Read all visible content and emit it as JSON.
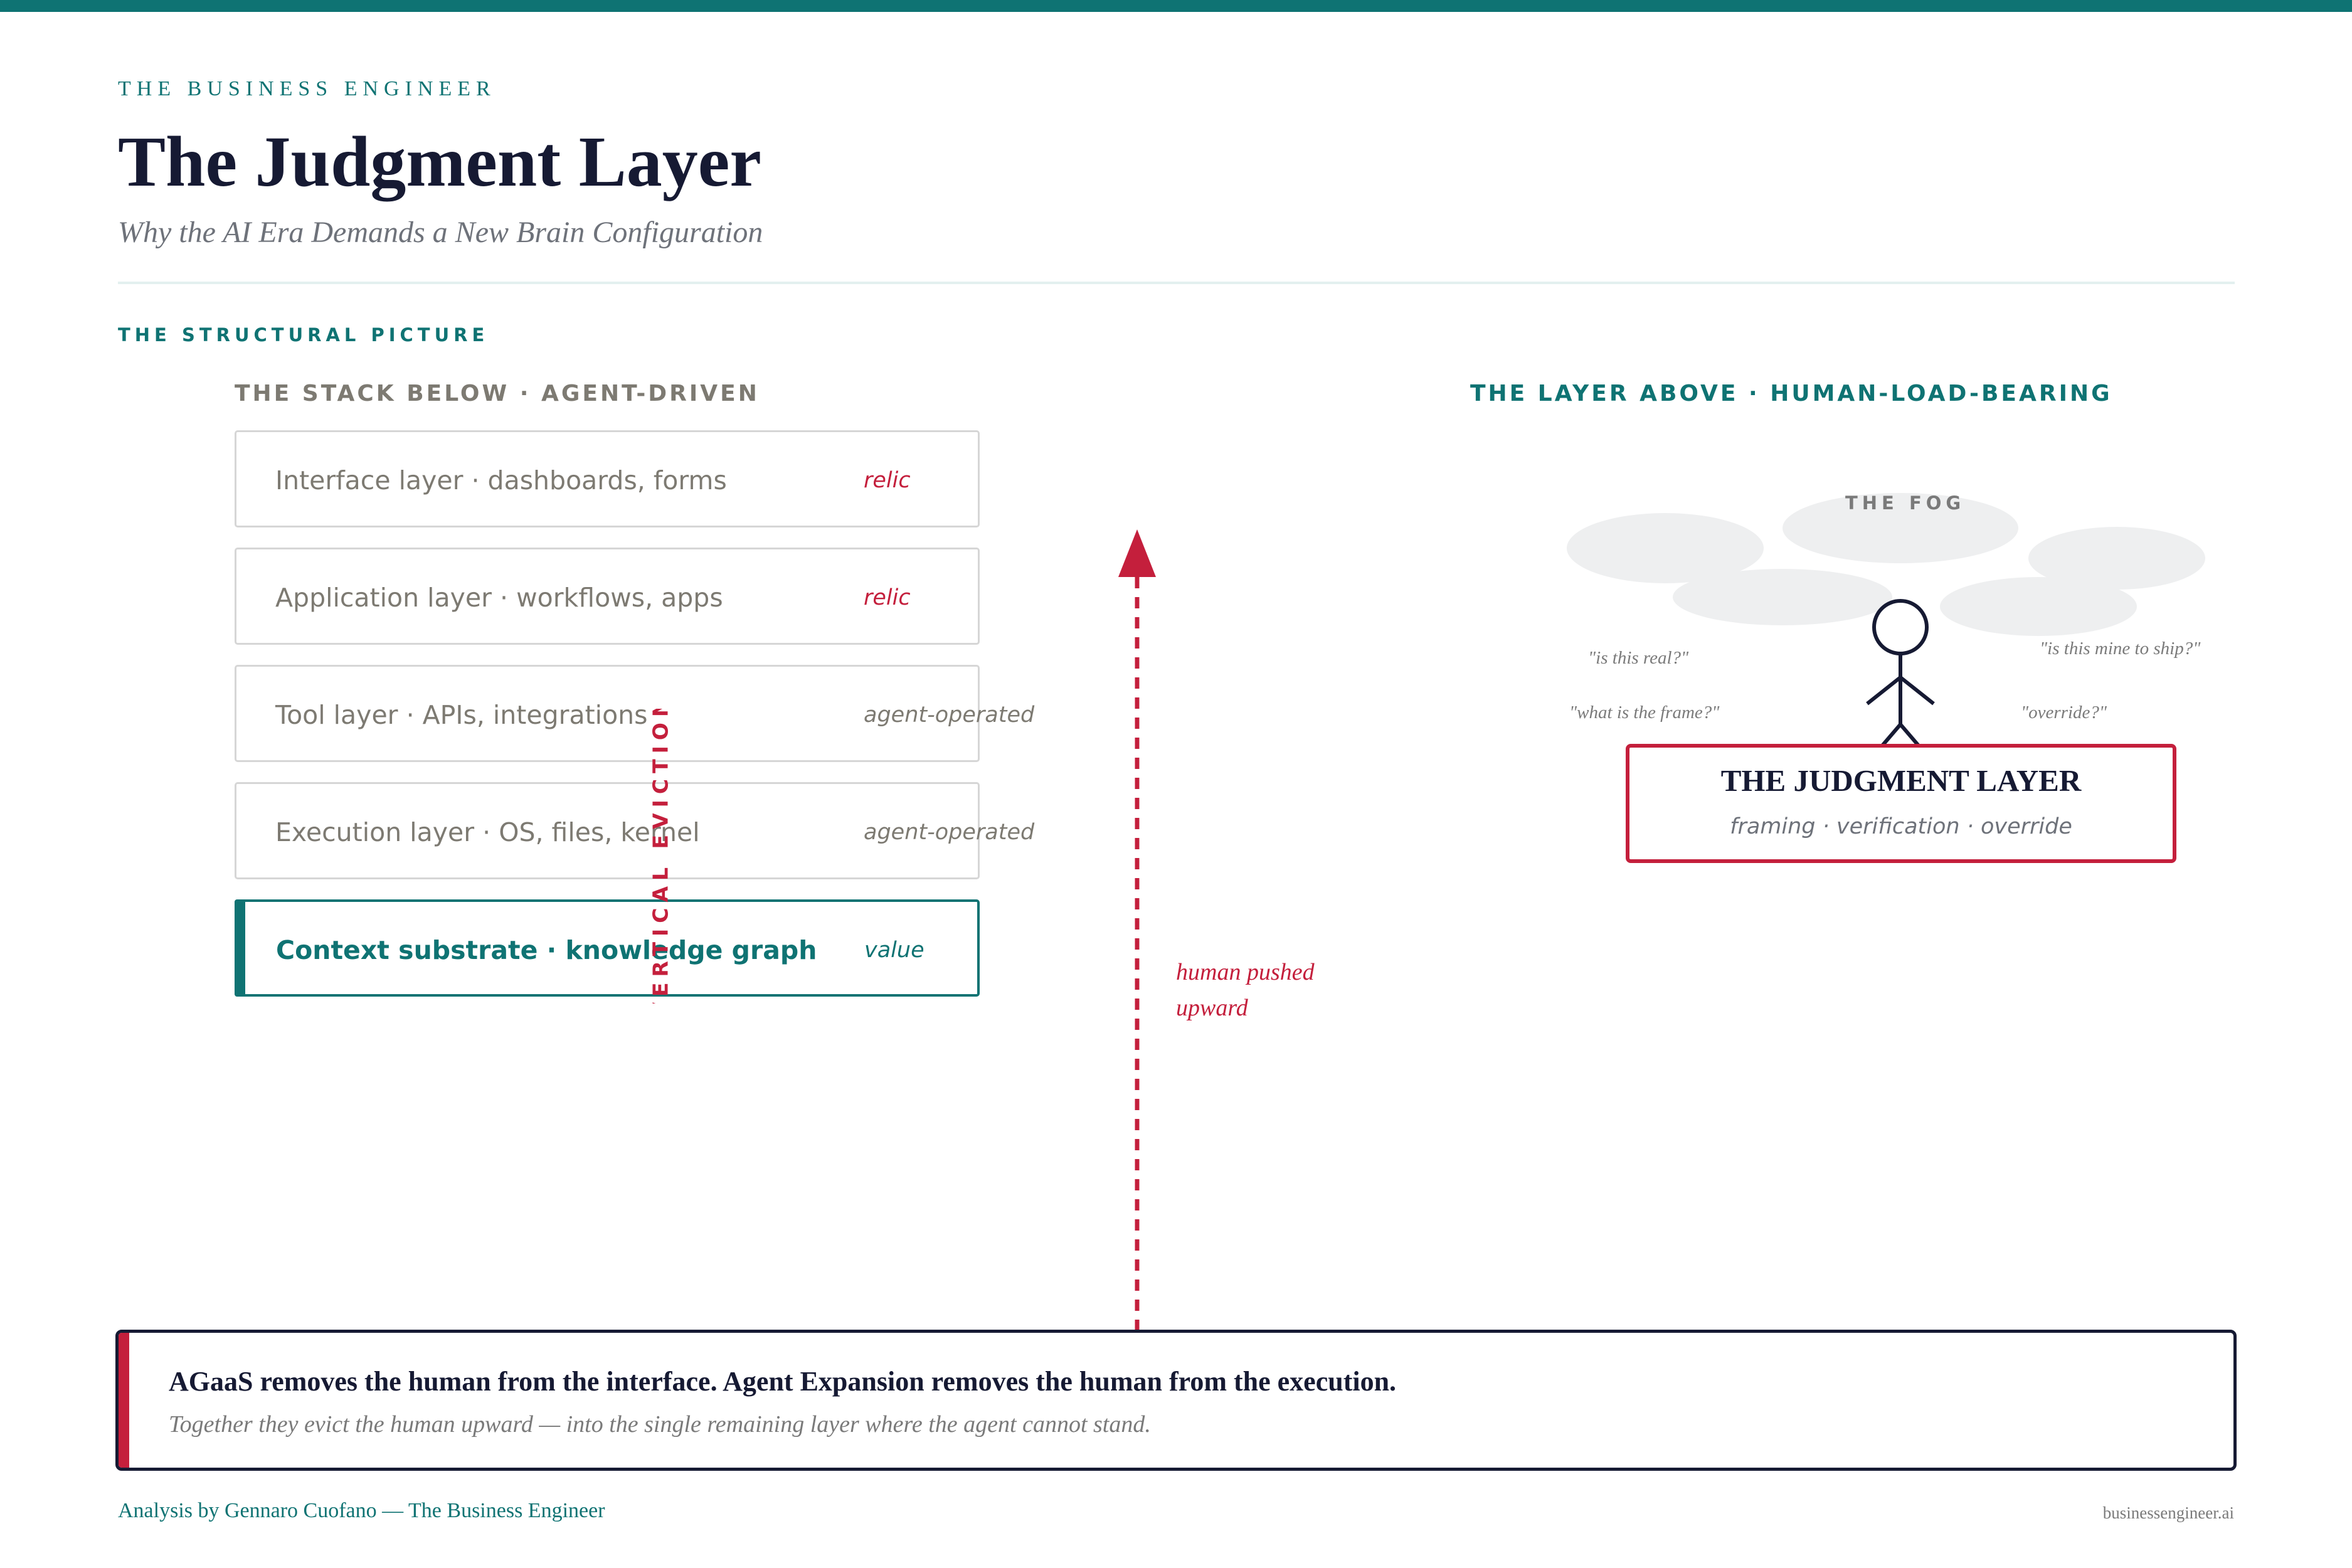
{
  "header": {
    "brand": "THE BUSINESS ENGINEER",
    "title": "The Judgment Layer",
    "subtitle": "Why the AI Era Demands a New Brain Configuration"
  },
  "section_label": "THE STRUCTURAL PICTURE",
  "left_column": {
    "heading": "THE STACK BELOW · AGENT-DRIVEN",
    "layers": [
      {
        "name": "Interface layer · dashboards, forms",
        "tag": "relic",
        "status": "relic"
      },
      {
        "name": "Application layer · workflows, apps",
        "tag": "relic",
        "status": "relic"
      },
      {
        "name": "Tool layer · APIs, integrations",
        "tag": "agent-operated",
        "status": "agent"
      },
      {
        "name": "Execution layer · OS, files, kernel",
        "tag": "agent-operated",
        "status": "agent"
      },
      {
        "name": "Context substrate · knowledge graph",
        "tag": "value",
        "status": "value"
      }
    ],
    "eviction_label": "VERTICAL EVICTION"
  },
  "arrow": {
    "label_line1": "human pushed",
    "label_line2": "upward"
  },
  "right_column": {
    "heading": "THE LAYER ABOVE · HUMAN-LOAD-BEARING",
    "fog_label": "THE FOG",
    "questions": [
      "\"is this real?\"",
      "\"is this mine to ship?\"",
      "\"what is the frame?\"",
      "\"override?\""
    ],
    "judgment_title": "THE JUDGMENT LAYER",
    "judgment_sub": "framing · verification · override"
  },
  "callout": {
    "main": "AGaaS removes the human from the interface. Agent Expansion removes the human from the execution.",
    "sub": "Together they evict the human upward — into the single remaining layer where the agent cannot stand."
  },
  "footer": {
    "left": "Analysis by Gennaro Cuofano — The Business Engineer",
    "right": "businessengineer.ai"
  },
  "colors": {
    "teal": "#0f7373",
    "crimson": "#c41f3c",
    "navy": "#161a33",
    "muted": "#7d7a72",
    "fog": "#eeeff0"
  },
  "icons": {
    "person": "stick-figure-icon",
    "arrow": "arrow-up-icon"
  }
}
